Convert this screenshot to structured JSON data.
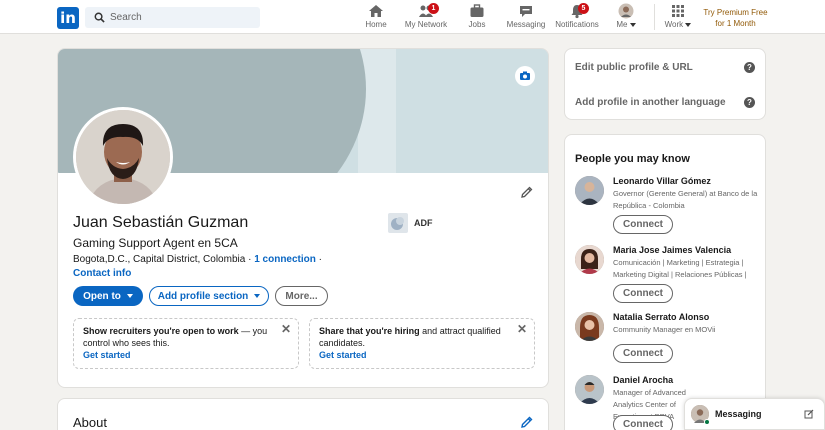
{
  "nav": {
    "logo": "in",
    "search_placeholder": "Search",
    "items": [
      {
        "label": "Home",
        "icon": "home-icon"
      },
      {
        "label": "My Network",
        "icon": "network-icon",
        "badge": "1"
      },
      {
        "label": "Jobs",
        "icon": "briefcase-icon"
      },
      {
        "label": "Messaging",
        "icon": "messaging-icon"
      },
      {
        "label": "Notifications",
        "icon": "bell-icon",
        "badge": "5"
      },
      {
        "label": "Me",
        "icon": "avatar"
      },
      {
        "label": "Work",
        "icon": "grid-icon"
      }
    ],
    "premium_line1": "Try Premium Free",
    "premium_line2": "for 1 Month"
  },
  "profile": {
    "name": "Juan Sebastián Guzman",
    "headline": "Gaming Support Agent en 5CA",
    "location": "Bogota,D.C., Capital District, Colombia",
    "sep": "·",
    "connections": "1 connection",
    "contact": "Contact info",
    "org": "ADF",
    "open_to": "Open to",
    "add_section": "Add profile section",
    "more": "More...",
    "notice1_bold": "Show recruiters you're open to work",
    "notice1_rest": " — you control who sees this.",
    "notice1_link": "Get started",
    "notice2_bold": "Share that you're hiring",
    "notice2_rest": " and attract qualified candidates.",
    "notice2_link": "Get started",
    "close": "✕"
  },
  "about": {
    "title": "About"
  },
  "sidebar": {
    "edit_url": "Edit public profile & URL",
    "add_language": "Add profile in another language",
    "help": "?",
    "pymk_title": "People you may know",
    "people": [
      {
        "name": "Leonardo Villar Gómez",
        "desc": "Governor (Gerente General) at Banco de la República - Colombia",
        "connect": "Connect"
      },
      {
        "name": "Maria Jose Jaimes Valencia",
        "desc": "Comunicación | Marketing | Estrategia | Marketing Digital | Relaciones Públicas |",
        "connect": "Connect"
      },
      {
        "name": "Natalia Serrato Alonso",
        "desc": "Community Manager en MOVii",
        "connect": "Connect"
      },
      {
        "name": "Daniel Arocha",
        "desc": "Manager of Advanced Analytics Center of Expertise at BBVA",
        "connect": "Connect"
      }
    ]
  },
  "messaging": {
    "label": "Messaging"
  },
  "colors": {
    "brand": "#0a66c2",
    "badge": "#cc1016",
    "premium": "#915907"
  }
}
